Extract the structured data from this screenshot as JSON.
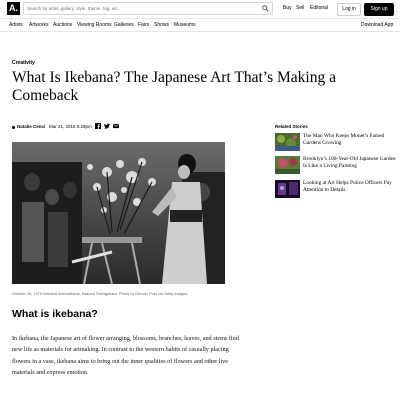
{
  "header": {
    "logo_text": "A.",
    "search_placeholder": "Search by artist, gallery, style, theme, tag, etc.",
    "links": [
      "Buy",
      "Sell",
      "Editorial"
    ],
    "login_label": "Log in",
    "signup_label": "Sign up"
  },
  "subnav": {
    "items": [
      "Artists",
      "Artworks",
      "Auctions",
      "Viewing Rooms",
      "Galleries",
      "Fairs",
      "Shows",
      "Museums"
    ],
    "download": "Download App"
  },
  "article": {
    "category": "Creativity",
    "title": "What Is Ikebana? The Japanese Art That’s Making a Comeback",
    "author": "Natalie Cenci",
    "date": "Mar 21, 2018 6:29pm",
    "caption": "October 26, 1975 Ikebana International, Kasumi Teshigahara. Photo by Denver Post via Getty Images.",
    "section_heading": "What is ikebana?",
    "body": "In ikebana, the Japanese art of flower arranging, blossoms, branches, leaves, and stems find new life as materials for artmaking. In contrast to the western habits of casually placing flowers in a vase, ikebana aims to bring out the inner qualities of flowers and other live materials and express emotion."
  },
  "related": {
    "heading": "Related Stories",
    "items": [
      {
        "title": "The Man Who Keeps Monet’s Famed Gardens Growing",
        "thumb_color": "#6a8a3a"
      },
      {
        "title": "Brooklyn’s 100-Year-Old Japanese Garden Is Like a Living Painting",
        "thumb_color": "#8a4a3a"
      },
      {
        "title": "Looking at Art Helps Police Officers Pay Attention to Details",
        "thumb_color": "#5a2a6a"
      }
    ]
  },
  "icons": [
    "search-icon",
    "facebook-icon",
    "twitter-icon",
    "email-icon"
  ]
}
